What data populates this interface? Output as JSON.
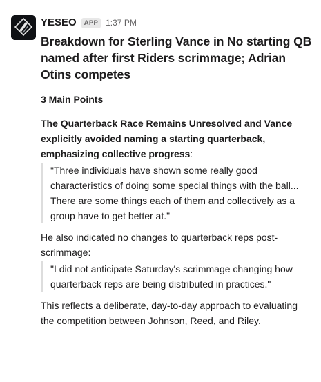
{
  "sender": {
    "name": "YESEO",
    "badge": "APP",
    "time": "1:37 PM",
    "avatar_icon": "yeseo-logo-icon"
  },
  "message": {
    "headline": "Breakdown for Sterling Vance in No starting QB named after first Riders scrimmage; Adrian Otins competes",
    "section_title": "3 Main Points",
    "intro_bold": "The Quarterback Race Remains Unresolved and Vance explicitly avoided naming a starting quarterback, emphasizing collective progress",
    "intro_colon": ":",
    "quote_1": "\"Three individuals have shown some really good characteristics of doing some special things with the ball... There are some things each of them and collectively as a group have to get better at.\"",
    "followup": "He also indicated no changes to quarterback reps post-scrimmage:",
    "quote_2": "\"I did not anticipate Saturday's scrimmage changing how quarterback reps are being distributed in practices.\"",
    "closing": "This reflects a deliberate, day-to-day approach to evaluating the competition between Johnson, Reed, and Riley."
  }
}
